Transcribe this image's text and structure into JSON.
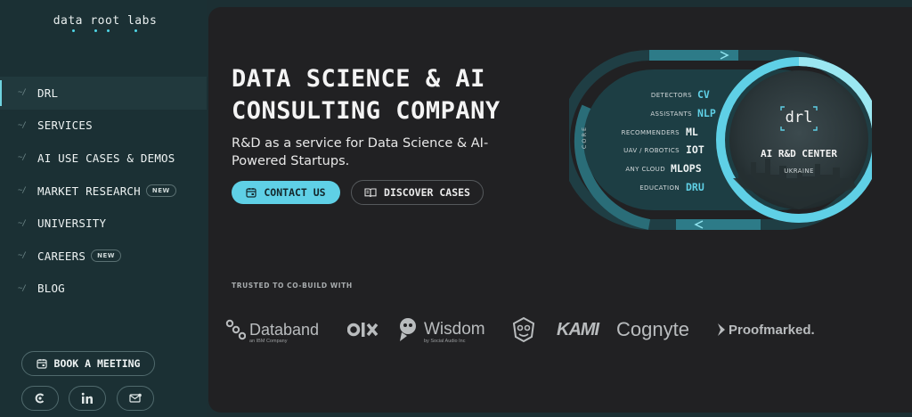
{
  "brand": {
    "logo_text": "data root labs"
  },
  "sidebar": {
    "nav_prefix": "~/",
    "items": [
      {
        "label": "DRL",
        "badge": ""
      },
      {
        "label": "SERVICES",
        "badge": ""
      },
      {
        "label": "AI USE CASES & DEMOS",
        "badge": ""
      },
      {
        "label": "MARKET RESEARCH",
        "badge": "NEW"
      },
      {
        "label": "UNIVERSITY",
        "badge": ""
      },
      {
        "label": "CAREERS",
        "badge": "NEW"
      },
      {
        "label": "BLOG",
        "badge": ""
      }
    ],
    "active_index": 0,
    "book_label": "BOOK A MEETING",
    "social_icons": [
      "clutch-icon",
      "linkedin-icon",
      "email-icon"
    ]
  },
  "hero": {
    "title": "DATA SCIENCE & AI CONSULTING COMPANY",
    "subtitle": "R&D as a service for Data Science & AI-Powered Startups.",
    "contact_label": "CONTACT US",
    "discover_label": "DISCOVER CASES"
  },
  "graphic": {
    "core_label": "CORE",
    "rows": [
      {
        "caption": "DETECTORS",
        "tech": "CV",
        "highlight": true
      },
      {
        "caption": "ASSISTANTS",
        "tech": "NLP",
        "highlight": true
      },
      {
        "caption": "RECOMMENDERS",
        "tech": "ML",
        "highlight": false
      },
      {
        "caption": "UAV / ROBOTICS",
        "tech": "IOT",
        "highlight": false
      },
      {
        "caption": "ANY CLOUD",
        "tech": "MLOPS",
        "highlight": false
      },
      {
        "caption": "EDUCATION",
        "tech": "DRU",
        "highlight": true
      }
    ],
    "center_logo": "drl",
    "center_title": "AI R&D CENTER",
    "center_subtitle": "UKRAINE"
  },
  "trusted": {
    "label": "TRUSTED TO CO-BUILD WITH",
    "partners": [
      {
        "name": "Databand",
        "sub": "an IBM Company"
      },
      {
        "name": "OLX",
        "sub": ""
      },
      {
        "name": "Wisdom",
        "sub": "by Social Audio Inc"
      },
      {
        "name": "",
        "sub": ""
      },
      {
        "name": "KAMI",
        "sub": ""
      },
      {
        "name": "Cognyte",
        "sub": ""
      },
      {
        "name": "Proofmarked.",
        "sub": ""
      }
    ]
  },
  "colors": {
    "accent": "#5fd0e6",
    "sidebar_bg": "#1b3034",
    "main_bg": "#212123"
  }
}
